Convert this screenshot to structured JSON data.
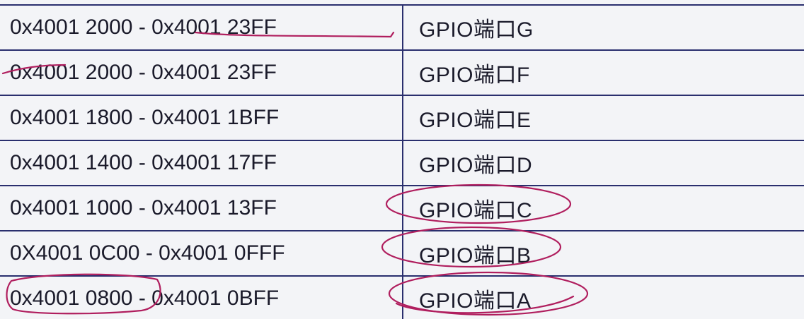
{
  "rows": [
    {
      "range": "0x4001 2000 - 0x4001 23FF",
      "peripheral": "GPIO端口G"
    },
    {
      "range": "0x4001 2000 - 0x4001 23FF",
      "peripheral": "GPIO端口F"
    },
    {
      "range": "0x4001 1800 - 0x4001 1BFF",
      "peripheral": "GPIO端口E"
    },
    {
      "range": "0x4001 1400 - 0x4001 17FF",
      "peripheral": "GPIO端口D"
    },
    {
      "range": "0x4001 1000 - 0x4001 13FF",
      "peripheral": "GPIO端口C"
    },
    {
      "range": "0X4001 0C00 - 0x4001 0FFF",
      "peripheral": "GPIO端口B"
    },
    {
      "range": "0x4001 0800 - 0x4001 0BFF",
      "peripheral": "GPIO端口A"
    }
  ],
  "annotation_color": "#b01e5e"
}
